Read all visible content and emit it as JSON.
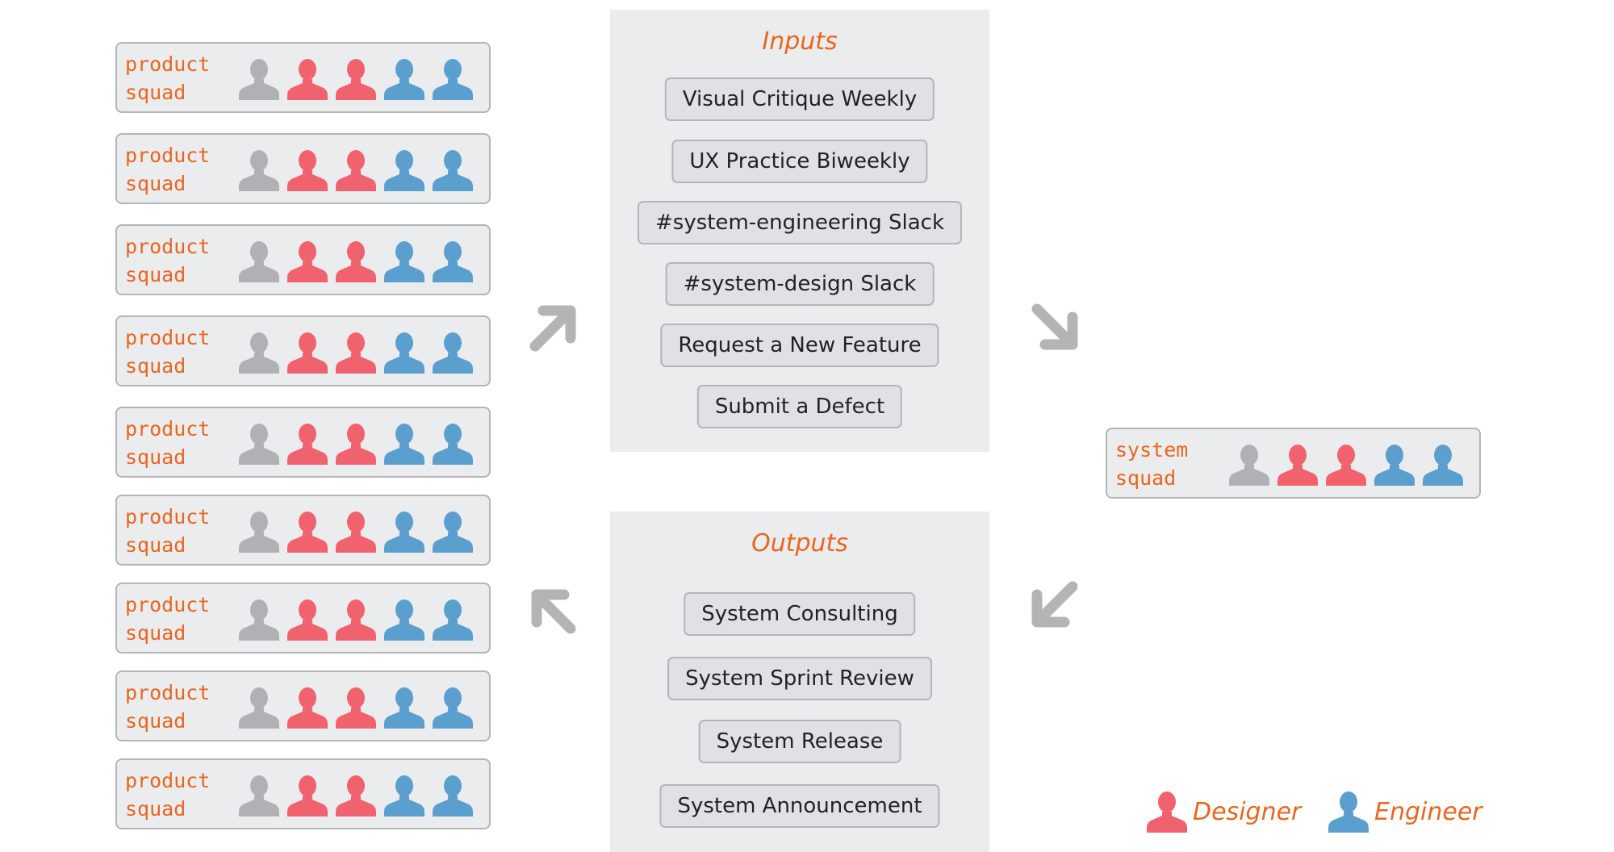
{
  "colors": {
    "accent_text": "#e8661f",
    "neutral_person": "#b0b1b4",
    "designer": "#f0636e",
    "engineer": "#5b9fcf",
    "arrow": "#b4b4b4",
    "panel_bg": "#ebecee"
  },
  "product_squads": [
    {
      "label_line1": "product",
      "label_line2": "squad",
      "members": [
        "neutral",
        "designer",
        "designer",
        "engineer",
        "engineer"
      ]
    },
    {
      "label_line1": "product",
      "label_line2": "squad",
      "members": [
        "neutral",
        "designer",
        "designer",
        "engineer",
        "engineer"
      ]
    },
    {
      "label_line1": "product",
      "label_line2": "squad",
      "members": [
        "neutral",
        "designer",
        "designer",
        "engineer",
        "engineer"
      ]
    },
    {
      "label_line1": "product",
      "label_line2": "squad",
      "members": [
        "neutral",
        "designer",
        "designer",
        "engineer",
        "engineer"
      ]
    },
    {
      "label_line1": "product",
      "label_line2": "squad",
      "members": [
        "neutral",
        "designer",
        "designer",
        "engineer",
        "engineer"
      ]
    },
    {
      "label_line1": "product",
      "label_line2": "squad",
      "members": [
        "neutral",
        "designer",
        "designer",
        "engineer",
        "engineer"
      ]
    },
    {
      "label_line1": "product",
      "label_line2": "squad",
      "members": [
        "neutral",
        "designer",
        "designer",
        "engineer",
        "engineer"
      ]
    },
    {
      "label_line1": "product",
      "label_line2": "squad",
      "members": [
        "neutral",
        "designer",
        "designer",
        "engineer",
        "engineer"
      ]
    },
    {
      "label_line1": "product",
      "label_line2": "squad",
      "members": [
        "neutral",
        "designer",
        "designer",
        "engineer",
        "engineer"
      ]
    }
  ],
  "system_squad": {
    "label_line1": "system",
    "label_line2": "squad",
    "members": [
      "neutral",
      "designer",
      "designer",
      "engineer",
      "engineer"
    ]
  },
  "inputs": {
    "title": "Inputs",
    "items": [
      "Visual Critique Weekly",
      "UX Practice Biweekly",
      "#system-engineering Slack",
      "#system-design Slack",
      "Request a New Feature",
      "Submit a Defect"
    ]
  },
  "outputs": {
    "title": "Outputs",
    "items": [
      "System Consulting",
      "System Sprint Review",
      "System Release",
      "System Announcement"
    ]
  },
  "arrows": [
    "arrow-up-right",
    "arrow-down-right",
    "arrow-down-left",
    "arrow-up-left"
  ],
  "legend": {
    "designer_label": "Designer",
    "engineer_label": "Engineer"
  }
}
